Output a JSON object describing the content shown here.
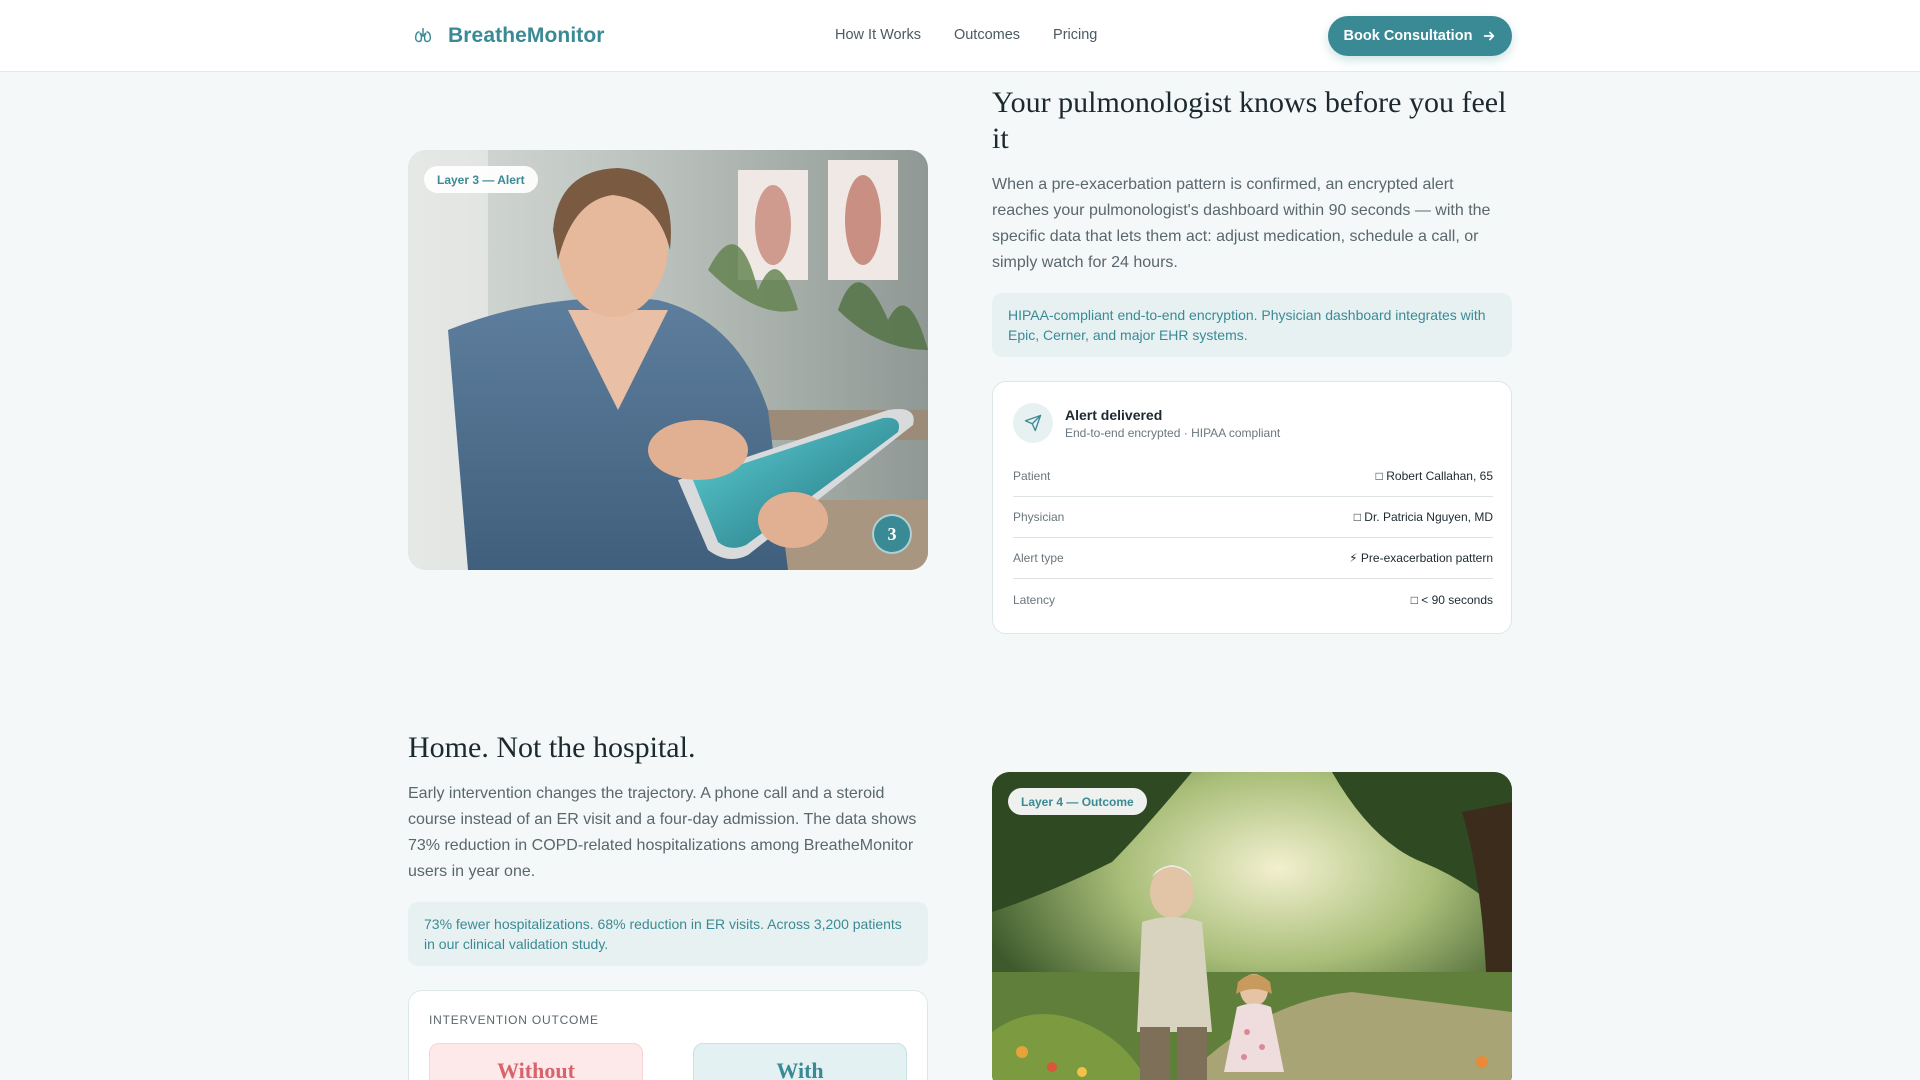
{
  "nav": {
    "brand": "BreatheMonitor",
    "links": [
      "How It Works",
      "Outcomes",
      "Pricing"
    ],
    "cta": "Book Consultation"
  },
  "layer3": {
    "badge": "Layer 3 — Alert",
    "step": "3",
    "title": "Your pulmonologist knows before you feel it",
    "body": "When a pre-exacerbation pattern is confirmed, an encrypted alert reaches your pulmonologist's dashboard within 90 seconds — with the specific data that lets them act: adjust medication, schedule a call, or simply watch for 24 hours.",
    "callout": "HIPAA-compliant end-to-end encryption. Physician dashboard integrates with Epic, Cerner, and major EHR systems.",
    "alert": {
      "title": "Alert delivered",
      "subtitle": "End-to-end encrypted · HIPAA compliant",
      "rows": [
        {
          "label": "Patient",
          "icon": "□",
          "value": "Robert Callahan, 65"
        },
        {
          "label": "Physician",
          "icon": "□",
          "value": "Dr. Patricia Nguyen, MD"
        },
        {
          "label": "Alert type",
          "icon": "⚡",
          "value": "Pre-exacerbation pattern"
        },
        {
          "label": "Latency",
          "icon": "□",
          "value": "< 90 seconds"
        }
      ]
    }
  },
  "layer4": {
    "badge": "Layer 4 — Outcome",
    "title": "Home. Not the hospital.",
    "body": "Early intervention changes the trajectory. A phone call and a steroid course instead of an ER visit and a four-day admission. The data shows 73% reduction in COPD-related hospitalizations among BreatheMonitor users in year one.",
    "callout": "73% fewer hospitalizations. 68% reduction in ER visits. Across 3,200 patients in our clinical validation study.",
    "outcome": {
      "label": "INTERVENTION OUTCOME",
      "without": "Without",
      "with": "With"
    }
  },
  "colors": {
    "accent": "#3a8a95",
    "background": "#f4f8f9",
    "callout_bg": "#e8f1f2",
    "without_bg": "#fde9ea",
    "without_text": "#d9636a"
  },
  "icons": {
    "brand": "lungs-icon",
    "cta": "arrow-right-icon",
    "alert": "send-icon"
  }
}
